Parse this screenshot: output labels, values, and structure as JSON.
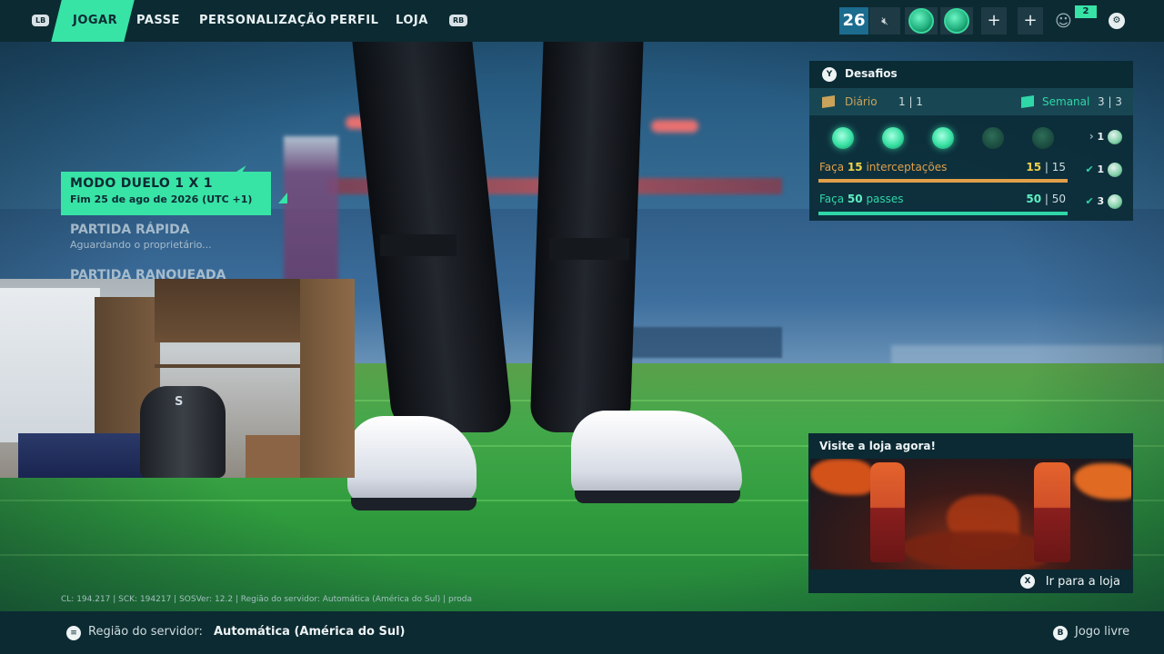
{
  "nav": {
    "lb": "LB",
    "rb": "RB",
    "tabs": [
      {
        "label": "JOGAR",
        "active": true
      },
      {
        "label": "PASSE"
      },
      {
        "label": "PERSONALIZAÇÃO"
      },
      {
        "label": "PERFIL"
      },
      {
        "label": "LOJA"
      }
    ],
    "player_level": "26",
    "friends_count": "2",
    "icons": [
      "mute-icon",
      "club-badge-icon",
      "ball-icon",
      "plus-icon",
      "plus-icon",
      "friends-icon",
      "settings-icon"
    ]
  },
  "modes": {
    "active": {
      "title": "MODO DUELO 1 X 1",
      "subtitle": "Fim 25 de ago de 2026 (UTC +1)"
    },
    "items": [
      {
        "title": "PARTIDA RÁPIDA",
        "subtitle": "Aguardando o proprietário..."
      },
      {
        "title": "PARTIDA RANQUEADA"
      }
    ]
  },
  "challenges": {
    "button": "Y",
    "title": "Desafios",
    "daily": {
      "label": "Diário",
      "count": "1 | 1"
    },
    "weekly": {
      "label": "Semanal",
      "count": "3 | 3"
    },
    "dots_completed": 3,
    "dots_total": 5,
    "tier_reward": "1",
    "items": [
      {
        "prefix": "Faça ",
        "amount": "15",
        "suffix": " interceptações",
        "value": "15",
        "goal": "15",
        "reward": "1",
        "color": "#e0a04a"
      },
      {
        "prefix": "Faça ",
        "amount": "50",
        "suffix": " passes",
        "value": "50",
        "goal": "50",
        "reward": "3",
        "color": "#2fd6a8"
      }
    ]
  },
  "shop": {
    "title": "Visite a loja agora!",
    "button": "X",
    "cta": "Ir para a loja"
  },
  "version_text": "CL: 194.217 | SCK: 194217 | SOSVer: 12.2 | Região do servidor: Automática (América do Sul) | proda",
  "footer": {
    "region_label": "Região do servidor:",
    "region_value": "Automática (América do Sul)",
    "back_button": "B",
    "free_play": "Jogo livre"
  },
  "colors": {
    "accent": "#38e3a6",
    "daily": "#c9a35a",
    "weekly": "#2fd6a8",
    "topbar": "#0c2a32"
  }
}
